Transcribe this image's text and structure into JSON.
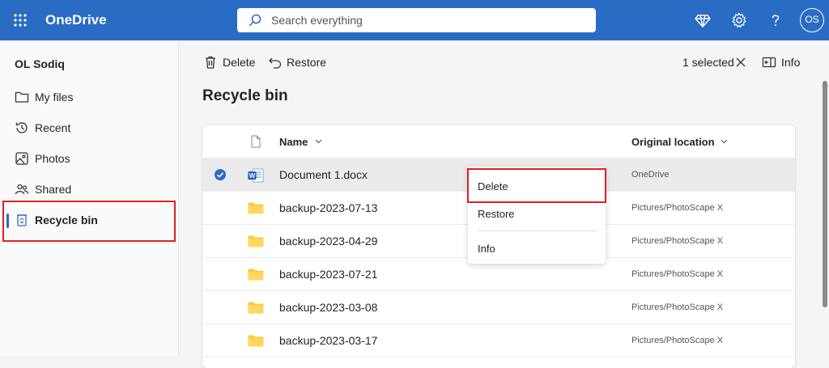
{
  "app": {
    "name": "OneDrive"
  },
  "search": {
    "placeholder": "Search everything"
  },
  "header": {
    "avatar_initials": "OS"
  },
  "sidebar": {
    "user": "OL Sodiq",
    "items": [
      {
        "label": "My files",
        "icon": "folder-icon"
      },
      {
        "label": "Recent",
        "icon": "history-icon"
      },
      {
        "label": "Photos",
        "icon": "photo-icon"
      },
      {
        "label": "Shared",
        "icon": "people-icon"
      },
      {
        "label": "Recycle bin",
        "icon": "recycle-bin-icon",
        "active": true
      }
    ]
  },
  "toolbar": {
    "delete_label": "Delete",
    "restore_label": "Restore",
    "selected_text": "1 selected",
    "info_label": "Info"
  },
  "page": {
    "title": "Recycle bin"
  },
  "table": {
    "columns": {
      "name": "Name",
      "location": "Original location"
    },
    "rows": [
      {
        "name": "Document 1.docx",
        "location": "OneDrive",
        "type": "word-doc",
        "selected": true
      },
      {
        "name": "backup-2023-07-13",
        "location": "Pictures/PhotoScape X",
        "type": "folder"
      },
      {
        "name": "backup-2023-04-29",
        "location": "Pictures/PhotoScape X",
        "type": "folder"
      },
      {
        "name": "backup-2023-07-21",
        "location": "Pictures/PhotoScape X",
        "type": "folder"
      },
      {
        "name": "backup-2023-03-08",
        "location": "Pictures/PhotoScape X",
        "type": "folder"
      },
      {
        "name": "backup-2023-03-17",
        "location": "Pictures/PhotoScape X",
        "type": "folder"
      }
    ]
  },
  "context_menu": {
    "delete": "Delete",
    "restore": "Restore",
    "info": "Info"
  },
  "colors": {
    "brand": "#2a6cc4",
    "highlight": "#e02020"
  }
}
